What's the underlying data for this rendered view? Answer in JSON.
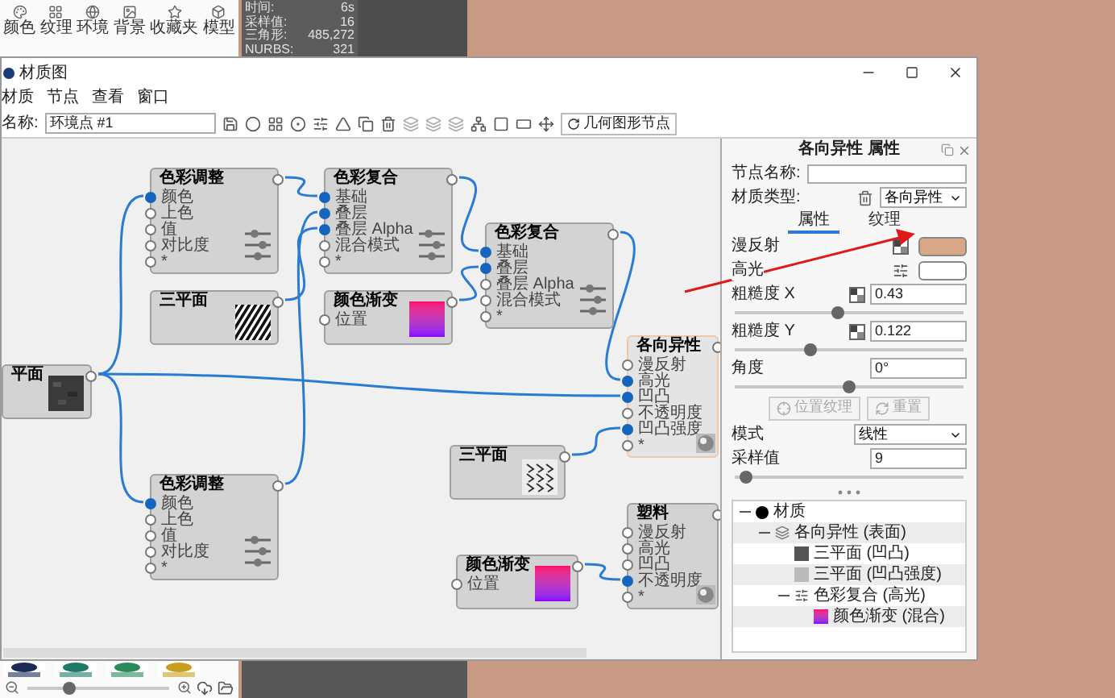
{
  "library": {
    "tabs": [
      {
        "label": "颜色"
      },
      {
        "label": "纹理"
      },
      {
        "label": "环境"
      },
      {
        "label": "背景"
      },
      {
        "label": "收藏夹"
      },
      {
        "label": "模型"
      }
    ],
    "stats": [
      {
        "label": "时间:",
        "value": "6s"
      },
      {
        "label": "采样值:",
        "value": "16"
      },
      {
        "label": "三角形:",
        "value": "485,272"
      },
      {
        "label": "NURBS:",
        "value": "321"
      }
    ],
    "zoom": {
      "level": 0.3
    }
  },
  "window": {
    "title": "材质图",
    "menu": [
      "材质",
      "节点",
      "查看",
      "窗口"
    ],
    "name_label": "名称:",
    "name_value": "环境点 #1",
    "geometry_button": "几何图形节点"
  },
  "graph": {
    "nodes": [
      {
        "title": "平面",
        "kind": "noise",
        "selected": false
      },
      {
        "title": "色彩调整",
        "kind": "sliders",
        "selected": false,
        "ports": [
          {
            "label": "颜色",
            "connected": true
          },
          {
            "label": "上色",
            "connected": false
          },
          {
            "label": "值",
            "connected": false
          },
          {
            "label": "对比度",
            "connected": false
          },
          {
            "label": "*",
            "connected": false
          }
        ]
      },
      {
        "title": "三平面",
        "kind": "stripes",
        "selected": false
      },
      {
        "title": "色彩调整",
        "kind": "sliders",
        "selected": false,
        "ports": [
          {
            "label": "颜色",
            "connected": true
          },
          {
            "label": "上色",
            "connected": false
          },
          {
            "label": "值",
            "connected": false
          },
          {
            "label": "对比度",
            "connected": false
          },
          {
            "label": "*",
            "connected": false
          }
        ]
      },
      {
        "title": "色彩复合",
        "kind": "sliders",
        "selected": false,
        "ports": [
          {
            "label": "基础",
            "connected": true
          },
          {
            "label": "叠层",
            "connected": true
          },
          {
            "label": "叠层 Alpha",
            "connected": true
          },
          {
            "label": "混合模式",
            "connected": false
          },
          {
            "label": "*",
            "connected": false
          }
        ]
      },
      {
        "title": "颜色渐变",
        "kind": "gradient",
        "selected": false,
        "ports": [
          {
            "label": "位置",
            "connected": false
          }
        ]
      },
      {
        "title": "色彩复合",
        "kind": "sliders",
        "selected": false,
        "ports": [
          {
            "label": "基础",
            "connected": true
          },
          {
            "label": "叠层",
            "connected": true
          },
          {
            "label": "叠层 Alpha",
            "connected": false
          },
          {
            "label": "混合模式",
            "connected": false
          },
          {
            "label": "*",
            "connected": false
          }
        ]
      },
      {
        "title": "各向异性",
        "kind": "sphere",
        "selected": true,
        "ports": [
          {
            "label": "漫反射",
            "connected": false
          },
          {
            "label": "高光",
            "connected": true
          },
          {
            "label": "凹凸",
            "connected": true
          },
          {
            "label": "不透明度",
            "connected": false
          },
          {
            "label": "凹凸强度",
            "connected": true
          },
          {
            "label": "*",
            "connected": false
          }
        ]
      },
      {
        "title": "三平面",
        "kind": "dots",
        "selected": false
      },
      {
        "title": "颜色渐变",
        "kind": "gradient",
        "selected": false,
        "ports": [
          {
            "label": "位置",
            "connected": false
          }
        ]
      },
      {
        "title": "塑料",
        "kind": "sphere",
        "selected": false,
        "ports": [
          {
            "label": "漫反射",
            "connected": false
          },
          {
            "label": "高光",
            "connected": false
          },
          {
            "label": "凹凸",
            "connected": false
          },
          {
            "label": "不透明度",
            "connected": true
          },
          {
            "label": "*",
            "connected": false
          }
        ]
      }
    ]
  },
  "properties": {
    "title": "各向异性 属性",
    "node_name_label": "节点名称:",
    "material_type_label": "材质类型:",
    "material_type": "各向异性",
    "tabs": [
      {
        "label": "属性",
        "selected": true
      },
      {
        "label": "纹理",
        "selected": false
      }
    ],
    "rows": [
      {
        "kind": "texture",
        "label": "漫反射",
        "color": "#d8a886"
      },
      {
        "kind": "composite",
        "label": "高光",
        "color": "#ffffff"
      },
      {
        "kind": "slider",
        "label": "粗糙度 X",
        "mapped": true,
        "value": "0.43",
        "level": 0.45
      },
      {
        "kind": "slider",
        "label": "粗糙度 Y",
        "mapped": true,
        "value": "0.122",
        "level": 0.33
      },
      {
        "kind": "slider",
        "label": "角度",
        "mapped": false,
        "value": "0°",
        "level": 0.5
      },
      {
        "kind": "buttons",
        "buttons": [
          {
            "label": "位置纹理",
            "disabled": true
          },
          {
            "label": "重置",
            "disabled": true
          }
        ]
      },
      {
        "kind": "select",
        "label": "模式",
        "value": "线性"
      },
      {
        "kind": "slider",
        "label": "采样值",
        "mapped": false,
        "value": "9",
        "level": 0.05
      }
    ]
  },
  "tree": [
    {
      "label": "材质",
      "kind": "material",
      "expanded": true,
      "children": [
        {
          "label": "各向异性 (表面)",
          "kind": "surface",
          "expanded": true,
          "children": [
            {
              "label": "三平面 (凹凸)",
              "kind": "texture",
              "color": "#555555"
            },
            {
              "label": "三平面 (凹凸强度)",
              "kind": "texture",
              "color": "#bbbbbb"
            },
            {
              "label": "色彩复合 (高光)",
              "kind": "composite",
              "expanded": true,
              "children": [
                {
                  "label": "颜色渐变 (混合)",
                  "kind": "gradient"
                }
              ]
            }
          ]
        }
      ]
    }
  ]
}
